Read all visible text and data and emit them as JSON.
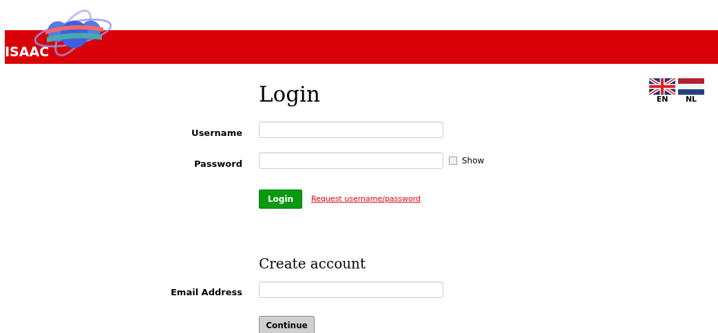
{
  "header": {
    "brand": "ISAAC"
  },
  "languages": [
    {
      "kind": "uk",
      "label": "EN"
    },
    {
      "kind": "nl",
      "label": "NL"
    }
  ],
  "login": {
    "title": "Login",
    "username_label": "Username",
    "password_label": "Password",
    "show": {
      "label": "Show",
      "checked": false
    },
    "button": "Login",
    "request_link": "Request username/password"
  },
  "create_account": {
    "title": "Create account",
    "email_label": "Email Address",
    "button": "Continue"
  }
}
